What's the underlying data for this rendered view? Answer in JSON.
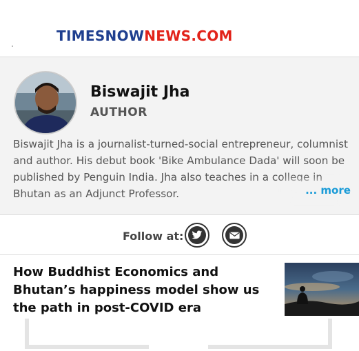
{
  "header": {
    "logo_part1": "TIMESNOW",
    "logo_part2": "NEWS.COM"
  },
  "author": {
    "name": "Biswajit Jha",
    "role": "AUTHOR",
    "bio": "Biswajit Jha is a journalist-turned-social entrepreneur, columnist and author. His debut book 'Bike Ambulance Dada' will soon be published by Penguin India. Jha also teaches in a college in Bhutan as an Adjunct Professor.",
    "more_label": "... more"
  },
  "follow": {
    "label": "Follow at:",
    "icons": [
      "twitter-icon",
      "email-icon"
    ]
  },
  "article": {
    "headline": "How Buddhist Economics and Bhutan’s happiness model show us the path in post-COVID era"
  },
  "colors": {
    "logo_blue": "#1f3f8f",
    "logo_red": "#e2231a",
    "more_link": "#1a9bd7",
    "card_bg": "#f3f3f3"
  }
}
